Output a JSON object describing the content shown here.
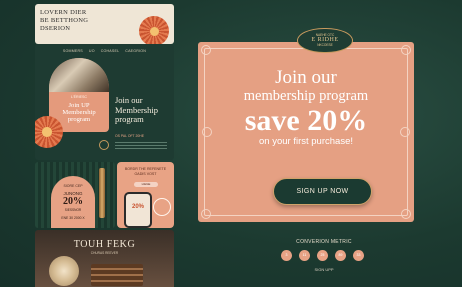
{
  "left": {
    "top_card": {
      "title": "LOVERN DIER\nBE BETTHONG\nDSERION"
    },
    "hero": {
      "nav": [
        "SOMMERS",
        "UO",
        "COHASEL",
        "CAEGRION"
      ],
      "arch_small": "L'ÉRIESC",
      "arch_text": "Join UP\nMembership\nprogram",
      "headline": "Join our\nMembership\nprogram",
      "small": "OS PAL OFT 20HE"
    },
    "mid_left": {
      "line1": "SIORE CEP",
      "line2": "JUNONG",
      "pct": "20%",
      "line3": "SIESSNOR",
      "line4": "ENE 30 2000 X"
    },
    "mid_right": {
      "text": "BORDR THE REFENETE\nOADIS VOST",
      "button": "LIEGE",
      "phone_pct": "20%"
    },
    "bottom_card": {
      "title": "TOUH FEKG",
      "sub": "CHURAS REEVER"
    }
  },
  "badge": {
    "top": "NAEHE OTC",
    "main": "E RIDHE",
    "bottom": "NKCOESE"
  },
  "promo": {
    "line1": "Join our",
    "line2": "membership program",
    "line3": "save 20%",
    "line4": "on your first purchase!",
    "cta": "SIGN UP NOW"
  },
  "metrics": {
    "label": "CONVERION METRIC",
    "dots": [
      "3",
      "11",
      "25",
      "89",
      "33"
    ],
    "sign": "SIGN UPP"
  }
}
